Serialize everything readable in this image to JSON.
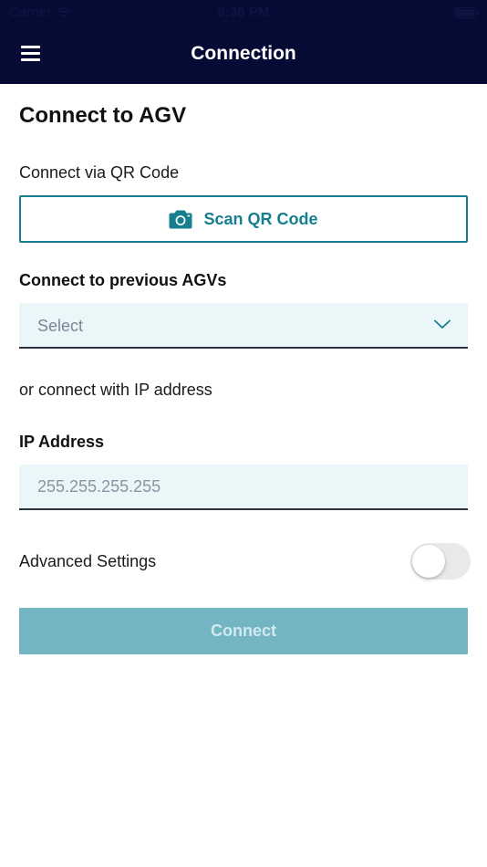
{
  "status_bar": {
    "carrier": "Carrier",
    "time": "8:36 PM"
  },
  "header": {
    "title": "Connection",
    "menu_icon": "hamburger-menu-icon"
  },
  "page": {
    "title": "Connect to AGV"
  },
  "qr_section": {
    "label": "Connect via QR Code",
    "button_label": "Scan QR Code",
    "button_icon": "camera-icon"
  },
  "previous_section": {
    "label": "Connect to previous AGVs",
    "select_value": "Select",
    "select_icon": "chevron-down-icon"
  },
  "ip_section": {
    "intro": "or connect with IP address",
    "label": "IP Address",
    "placeholder": "255.255.255.255",
    "value": ""
  },
  "advanced": {
    "label": "Advanced Settings",
    "enabled": false
  },
  "connect_button": {
    "label": "Connect",
    "enabled": false
  },
  "colors": {
    "header_bg": "#060b36",
    "accent": "#167f8f",
    "field_bg": "#eaf6f8",
    "button_disabled_bg": "#73b5c3",
    "button_disabled_text": "#d2e9ee"
  }
}
